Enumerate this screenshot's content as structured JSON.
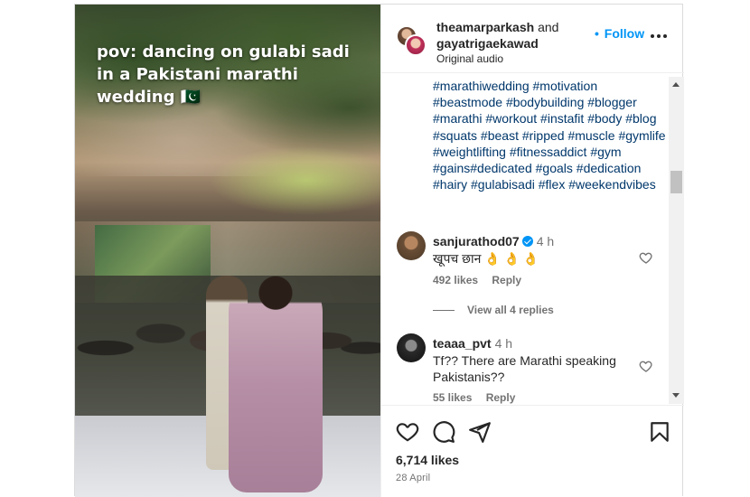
{
  "video": {
    "caption": "pov: dancing on gulabi sadi in a Pakistani marathi wedding 🇵🇰"
  },
  "header": {
    "author1": "theamarparkash",
    "and": "and",
    "author2": "gayatrigaekawad",
    "audio": "Original audio",
    "follow_label": "Follow",
    "follow_dot": "•",
    "more_icon": "more-horizontal-icon"
  },
  "caption": {
    "hashtags": "#marathiwedding #motivation #beastmode #bodybuilding #blogger #marathi #workout #instafit #body #blog #squats #beast #ripped #muscle #gymlife #weightlifting #fitnessaddict #gym #gains#dedicated #goals #dedication #hairy #gulabisadi #flex #weekendvibes"
  },
  "comments": [
    {
      "username": "sanjurathod07",
      "verified": true,
      "time": "4 h",
      "text": "खूपच छान 👌 👌 👌",
      "likes": "492 likes",
      "reply": "Reply"
    },
    {
      "username": "teaaa_pvt",
      "verified": false,
      "time": "4 h",
      "text": "Tf?? There are Marathi speaking Pakistanis??",
      "likes": "55 likes",
      "reply": "Reply"
    }
  ],
  "view_replies": "View all 4 replies",
  "actions": {
    "likes": "6,714 likes",
    "date": "28 April"
  },
  "colors": {
    "accent": "#0095f6",
    "hashtag": "#00376b",
    "muted": "#737373"
  }
}
